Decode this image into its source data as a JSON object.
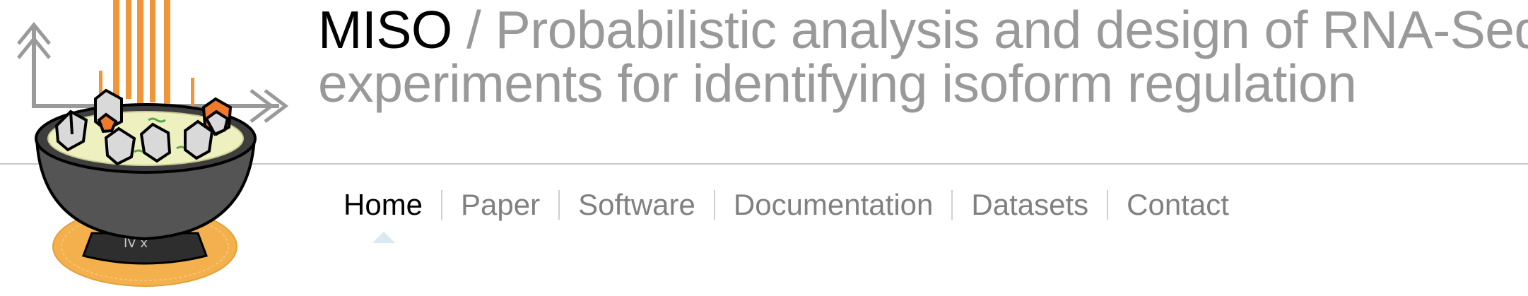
{
  "site": {
    "brand": "MISO",
    "separator": "/",
    "title_line1": "Probabilistic analysis and design of RNA-Seq",
    "title_line2": "experiments for identifying isoform regulation"
  },
  "logo": {
    "icon": "miso-soup-bowl-logo",
    "bowl_marking": "IV x"
  },
  "nav": {
    "items": [
      {
        "label": "Home",
        "active": true
      },
      {
        "label": "Paper",
        "active": false
      },
      {
        "label": "Software",
        "active": false
      },
      {
        "label": "Documentation",
        "active": false
      },
      {
        "label": "Datasets",
        "active": false
      },
      {
        "label": "Contact",
        "active": false
      }
    ]
  },
  "colors": {
    "brand_text": "#000000",
    "title_text": "#999999",
    "nav_text": "#808080",
    "nav_active_text": "#000000",
    "steam_orange": "#f0953a",
    "bowl_gray": "#4f4f4f",
    "soup_yellow": "#eef0c0",
    "mat_orange": "#f3b04d"
  }
}
